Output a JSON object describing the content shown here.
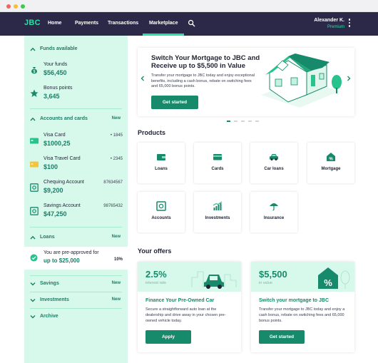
{
  "nav": {
    "logo": "JBC",
    "links": [
      {
        "label": "Home"
      },
      {
        "label": "Payments"
      },
      {
        "label": "Transactions"
      },
      {
        "label": "Marketplace"
      }
    ],
    "active_link": "Marketplace",
    "user": {
      "name": "Alexander K.",
      "tier": "Premium"
    }
  },
  "sidebar": {
    "funds": {
      "title": "Funds available",
      "items": [
        {
          "label": "Your funds",
          "value": "$56,450",
          "icon": "money-bag-icon"
        },
        {
          "label": "Bonus points",
          "value": "3,645",
          "icon": "star-badge-icon"
        }
      ]
    },
    "accounts": {
      "title": "Accounts and cards",
      "badge": "New",
      "items": [
        {
          "label": "Visa Card",
          "value": "$1000,25",
          "number": "• 1845",
          "icon": "card-green-icon"
        },
        {
          "label": "Visa Travel Card",
          "value": "$100",
          "number": "• 2345",
          "icon": "card-yellow-icon"
        },
        {
          "label": "Chequing Account",
          "value": "$9,200",
          "number": "87634567",
          "icon": "safe-icon"
        },
        {
          "label": "Savings Account",
          "value": "$47,250",
          "number": "98765432",
          "icon": "safe-icon"
        }
      ]
    },
    "loans": {
      "title": "Loans",
      "badge": "New",
      "preapproved": {
        "label": "You are pre-approved for",
        "value": "up to $25,000",
        "percent": "10%"
      }
    },
    "collapsed": [
      {
        "title": "Savings",
        "badge": "New"
      },
      {
        "title": "Investments",
        "badge": "New"
      },
      {
        "title": "Archive",
        "badge": ""
      }
    ]
  },
  "hero": {
    "title": "Switch Your Mortgage to JBC and Receive up to $5,500 in Value",
    "body": "Transfer your mortgage to JBC today and enjoy exceptional benefits, including a cash bonus, rebate on switching fees and 65,000 bonus points.",
    "button": "Get started",
    "slides": 5,
    "active_slide": 1
  },
  "products": {
    "title": "Products",
    "tiles": [
      {
        "label": "Loans",
        "icon": "wallet-icon"
      },
      {
        "label": "Cards",
        "icon": "card-icon"
      },
      {
        "label": "Car loans",
        "icon": "car-icon"
      },
      {
        "label": "Mortgage",
        "icon": "house-percent-icon"
      },
      {
        "label": "Accounts",
        "icon": "safe-icon"
      },
      {
        "label": "Investments",
        "icon": "growth-chart-icon"
      },
      {
        "label": "Insurance",
        "icon": "umbrella-icon"
      }
    ]
  },
  "offers": {
    "title": "Your offers",
    "cards": [
      {
        "big": "2.5%",
        "small": "interest rate",
        "title": "Finance Your Pre-Owned Car",
        "body": "Secure a straightforward auto loan at the dealership and drive away in your chosen pre-owned vehicle today.",
        "button": "Apply",
        "icon": "car-illustration-icon"
      },
      {
        "big": "$5,500",
        "small": "in value",
        "title": "Switch your mortgage to JBC",
        "body": "Transfer your mortgage to JBC today and enjoy a cash bonus, rebate on switching fees and 65,000 bonus points.",
        "button": "Get started",
        "icon": "house-percent-illustration-icon"
      }
    ]
  },
  "colors": {
    "nav_bg": "#2b2848",
    "accent": "#27e2a4",
    "primary": "#178a6b",
    "sidebar_bg": "#d7f9ec"
  }
}
